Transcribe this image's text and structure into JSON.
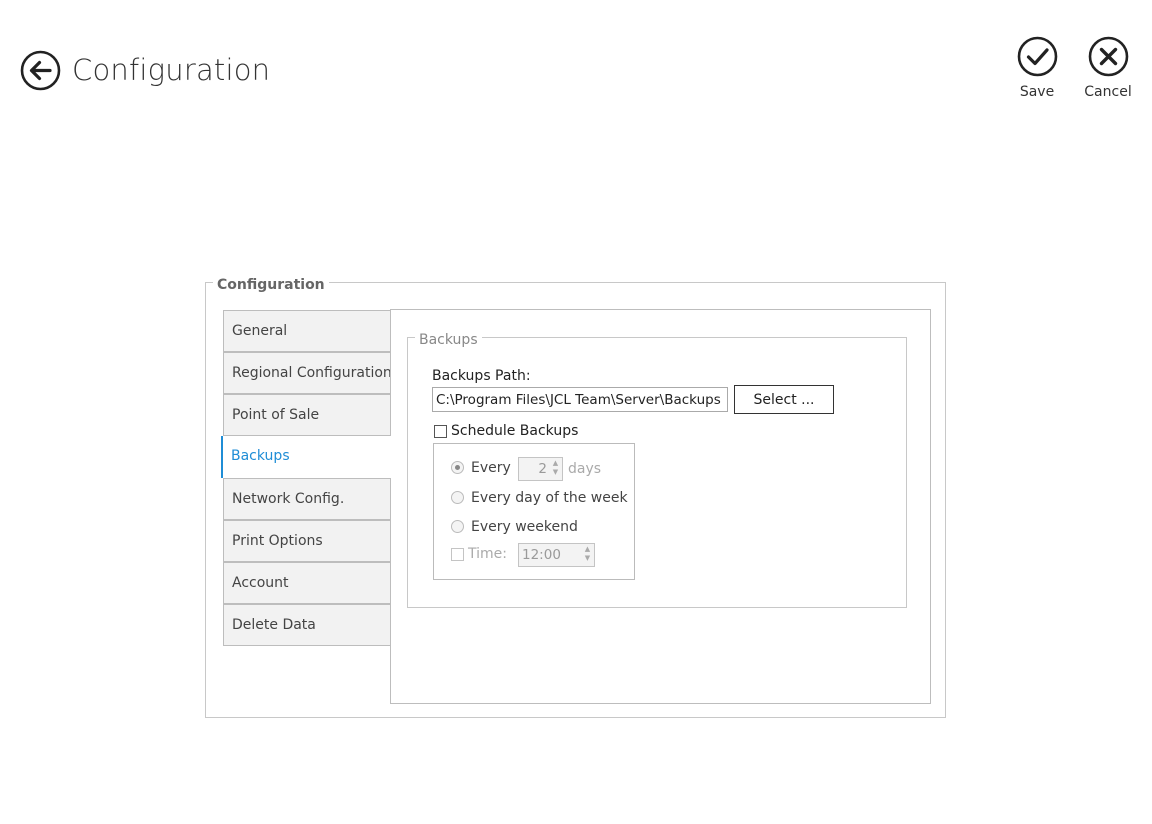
{
  "header": {
    "title": "Configuration",
    "save_label": "Save",
    "cancel_label": "Cancel"
  },
  "config": {
    "group_title": "Configuration",
    "tabs": [
      {
        "label": "General",
        "active": false
      },
      {
        "label": "Regional Configuration",
        "active": false
      },
      {
        "label": "Point of Sale",
        "active": false
      },
      {
        "label": "Backups",
        "active": true
      },
      {
        "label": "Network Config.",
        "active": false
      },
      {
        "label": "Print Options",
        "active": false
      },
      {
        "label": "Account",
        "active": false
      },
      {
        "label": "Delete Data",
        "active": false
      }
    ]
  },
  "backups": {
    "group_title": "Backups",
    "path_label": "Backups Path:",
    "path_value": "C:\\Program Files\\JCL Team\\Server\\Backups",
    "select_button": "Select ...",
    "schedule_label": "Schedule Backups",
    "schedule_checked": false,
    "options": {
      "every_label": "Every",
      "every_value": "2",
      "days_label": "days",
      "every_day_of_week_label": "Every day of the week",
      "every_weekend_label": "Every weekend",
      "time_label": "Time:",
      "time_value": "12:00"
    }
  },
  "icons": {
    "back": "arrow-left-circle",
    "save": "checkmark-circle",
    "cancel": "x-circle"
  },
  "colors": {
    "accent": "#1f8dd6"
  }
}
